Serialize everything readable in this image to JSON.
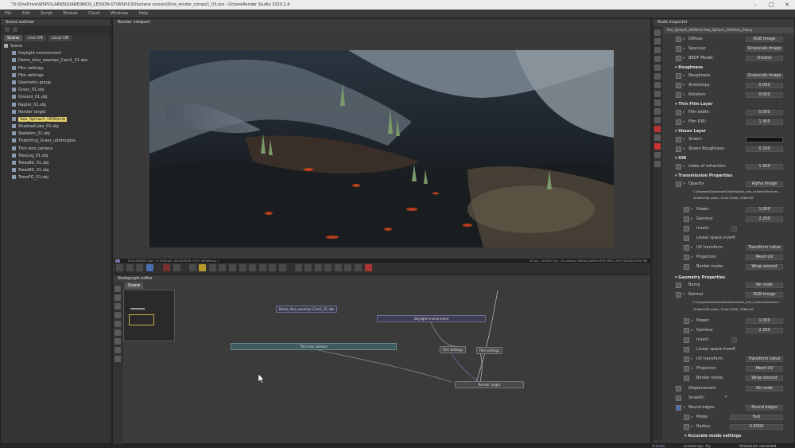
{
  "window": {
    "title": "\"D:\\OneDrive\\WSPU\\LARNSQUARE\\BROS_LESSON-07\\WSPU\\3D\\octane scenes\\Dino_render_compo1_03.ocs - OctaneRender Studio 2020.2.4",
    "controls": [
      "–",
      "□",
      "✕"
    ]
  },
  "menu": [
    "File",
    "Edit",
    "Script",
    "Module",
    "Cloud",
    "Windows",
    "Help"
  ],
  "outliner": {
    "title": "Scene outliner",
    "tabs": [
      "Scene",
      "Live DB",
      "Local DB"
    ],
    "items": [
      {
        "label": "Scene",
        "depth": 0
      },
      {
        "label": "Daylight environment",
        "depth": 1
      },
      {
        "label": "Demo_dino_swamps_Cam1_01.abc",
        "depth": 1
      },
      {
        "label": "Film settings",
        "depth": 1
      },
      {
        "label": "Film settings",
        "depth": 1
      },
      {
        "label": "Geometry group",
        "depth": 1
      },
      {
        "label": "Grass_01.obj",
        "depth": 1
      },
      {
        "label": "Ground_01.obj",
        "depth": 1
      },
      {
        "label": "Raptor_02.obj",
        "depth": 1
      },
      {
        "label": "Render target",
        "depth": 1
      },
      {
        "label": "Sea_Spinach_UHAlevia",
        "depth": 1,
        "selected": true
      },
      {
        "label": "ShadowCube_01.obj",
        "depth": 1
      },
      {
        "label": "Skeleton_01.obj",
        "depth": 1
      },
      {
        "label": "Thatching_Grass_uddmcgbia",
        "depth": 1
      },
      {
        "label": "Thin lens camera",
        "depth": 1
      },
      {
        "label": "TreeLog_01.obj",
        "depth": 1
      },
      {
        "label": "TreesBG_01.obj",
        "depth": 1
      },
      {
        "label": "TreesBG_01.obj",
        "depth": 1
      },
      {
        "label": "TreesFG_01.obj",
        "depth": 1
      }
    ]
  },
  "viewport": {
    "title": "Render viewport",
    "status_left": "120/140/5000 s/px, 37.6 Mp/sec, 00:00:26/00:13:57 (rendering...)",
    "status_right": "43 tex., 1944297 pri., 10 meshes, NVIDIA GeForce RTX 3090, 2437/10024/24576 MB"
  },
  "nodegraph": {
    "title": "Nodegraph editor",
    "tab": "Scene",
    "nodes": {
      "abc": "Demo_dino_swamps_Cam1_01.abc",
      "daylight": "Daylight environment",
      "camera": "Thin lens camera",
      "film1": "Film settings",
      "film2": "Film settings",
      "render_target": "Render target"
    }
  },
  "inspector": {
    "title": "Node inspector",
    "header_value": "Sea_Spinach_UHAlevia Sea_Spinach_UHAlevia_Glossy",
    "rows": [
      {
        "label": "Diffuse",
        "value": "RGB image"
      },
      {
        "label": "Specular",
        "value": "Greyscale image"
      },
      {
        "label": "BRDF Model:",
        "value": "Octane"
      }
    ],
    "roughness_section": "Roughness",
    "roughness_rows": [
      {
        "label": "Roughness",
        "value": "Greyscale image"
      },
      {
        "label": "Anisotropy:",
        "value": "0.000"
      },
      {
        "label": "Rotation:",
        "value": "0.000"
      }
    ],
    "thinfilm_section": "Thin Film Layer",
    "thinfilm_rows": [
      {
        "label": "Film width:",
        "value": "0.000"
      },
      {
        "label": "Film IOR:",
        "value": "1.450"
      }
    ],
    "sheen_section": "Sheen Layer",
    "sheen_rows": [
      {
        "label": "Sheen:",
        "value": ""
      },
      {
        "label": "Sheen Roughness:",
        "value": "0.200"
      }
    ],
    "ior_section": "IOR",
    "ior_rows": [
      {
        "label": "Index of refraction:",
        "value": "1.300"
      }
    ],
    "transmission_section": "Transmission Properties",
    "opacity": {
      "label": "Opacity",
      "value": "Alpha image"
    },
    "opacity_file": "C:\\Vegeeze\\Downloads\\Objets\\aalto_tree_uhAlevia\\Textures...",
    "opacity_info": "2048x2048 pixels, 32-bit RGBA, 16384 KB",
    "opacity_rows": [
      {
        "label": "Power:",
        "value": "1.000"
      },
      {
        "label": "Gamma:",
        "value": "2.200"
      },
      {
        "label": "Invert:",
        "value": ""
      },
      {
        "label": "Linear space invert:",
        "value": "✓"
      },
      {
        "label": "UV transform",
        "value": "Transform value"
      },
      {
        "label": "Projection",
        "value": "Mesh UV"
      },
      {
        "label": "Border mode:",
        "value": "Wrap around"
      }
    ],
    "geometry_section": "Geometry Properties",
    "bump": {
      "label": "Bump",
      "value": "No node"
    },
    "normal": {
      "label": "Normal",
      "value": "RGB image"
    },
    "normal_file": "C:\\Vegeeze\\Downloads\\Objets\\aalto_tree_uhAlevia\\Textures...",
    "normal_info": "2048x2048 pixels, 32-bit RGBA, 16384 KB",
    "normal_rows": [
      {
        "label": "Power:",
        "value": "1.000"
      },
      {
        "label": "Gamma:",
        "value": "2.200"
      },
      {
        "label": "Invert:",
        "value": ""
      },
      {
        "label": "Linear space invert:",
        "value": "✓"
      },
      {
        "label": "UV transform",
        "value": "Transform value"
      },
      {
        "label": "Projection",
        "value": "Mesh UV"
      },
      {
        "label": "Border mode:",
        "value": "Wrap around"
      }
    ],
    "displacement": {
      "label": "Displacement",
      "value": "No node"
    },
    "smooth": {
      "label": "Smooth:",
      "value": "✓"
    },
    "round_edges": {
      "label": "Round edges",
      "value": "Round edges"
    },
    "round_rows": [
      {
        "label": "Mode:",
        "value": "Fast"
      },
      {
        "label": "Radius:",
        "value": "0.0000"
      }
    ],
    "accurate_section": "Accurate mode settings"
  },
  "statusbar": {
    "activate": "Activate",
    "license": "License exp.: 0:y",
    "octanelive": "OctaneLive: connected"
  }
}
